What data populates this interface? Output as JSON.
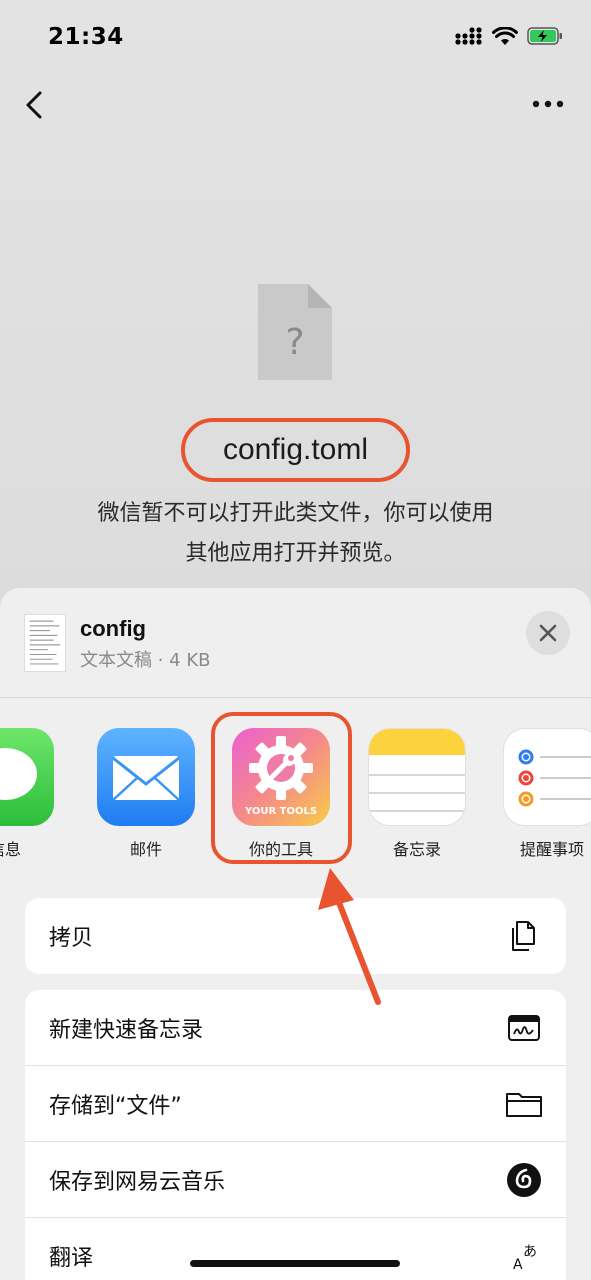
{
  "status_bar": {
    "time": "21:34"
  },
  "file": {
    "name": "config.toml",
    "message_line1": "微信暂不可以打开此类文件，你可以使用",
    "message_line2": "其他应用打开并预览。"
  },
  "sheet": {
    "title": "config",
    "meta": "文本文稿 · 4 KB",
    "apps": [
      {
        "label": "信息",
        "icon": "messages-icon"
      },
      {
        "label": "邮件",
        "icon": "mail-icon"
      },
      {
        "label": "你的工具",
        "icon": "your-tools-icon",
        "icon_text": "YOUR TOOLS"
      },
      {
        "label": "备忘录",
        "icon": "notes-icon"
      },
      {
        "label": "提醒事项",
        "icon": "reminders-icon"
      }
    ],
    "actions_group1": [
      {
        "label": "拷贝",
        "icon": "copy-icon"
      }
    ],
    "actions_group2": [
      {
        "label": "新建快速备忘录",
        "icon": "quick-note-icon"
      },
      {
        "label": "存储到“文件”",
        "icon": "folder-icon"
      },
      {
        "label": "保存到网易云音乐",
        "icon": "netease-music-icon"
      },
      {
        "label": "翻译",
        "icon": "translate-icon"
      }
    ]
  },
  "colors": {
    "highlight": "#e8542f",
    "mail": "#2f8ef5",
    "messages": "#35c759",
    "tools_gradient_start": "#f06ab0",
    "tools_gradient_end": "#f7c24a"
  }
}
